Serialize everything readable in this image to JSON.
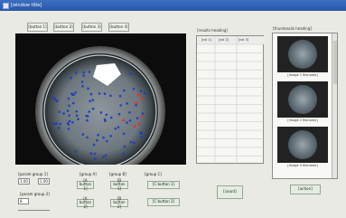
{
  "window": {
    "title": "[window title]"
  },
  "toolbar": [
    {
      "label": "[button 1]",
      "icon": ""
    },
    {
      "label": "[button 2]"
    },
    {
      "label": "[button 3]"
    },
    {
      "label": "[button 4]"
    }
  ],
  "results": {
    "title": "[results heading]",
    "columns": [
      "[col 1]",
      "[col 2]",
      "[col 3]"
    ],
    "row_count": 14
  },
  "thumbnails": {
    "title": "[thumbnails heading]",
    "items": [
      {
        "caption": "[image 1 filename]"
      },
      {
        "caption": "[image 2 filename]"
      },
      {
        "caption": "[image 3 filename]"
      }
    ]
  },
  "params": {
    "group1_label": "[param group 1]",
    "value_a": "1.00",
    "value_b": "1.00",
    "group2_label": "[param group 2]",
    "value_c": "8"
  },
  "groups": {
    "g1": {
      "label": "[group A]",
      "buttons": [
        "[A button 1]",
        "[A button 2]"
      ]
    },
    "g2": {
      "label": "[group B]",
      "buttons": [
        "[B button 1]",
        "[B button 2]"
      ]
    },
    "g3": {
      "label": "[group C]",
      "buttons": [
        "[C button 1]",
        "[C button 2]"
      ]
    }
  },
  "count_button": "[count]",
  "right_button": "[action]",
  "colors": {
    "accent": "#d33",
    "colony": "#1f3fbf",
    "button_bg": "#e3eee0"
  }
}
